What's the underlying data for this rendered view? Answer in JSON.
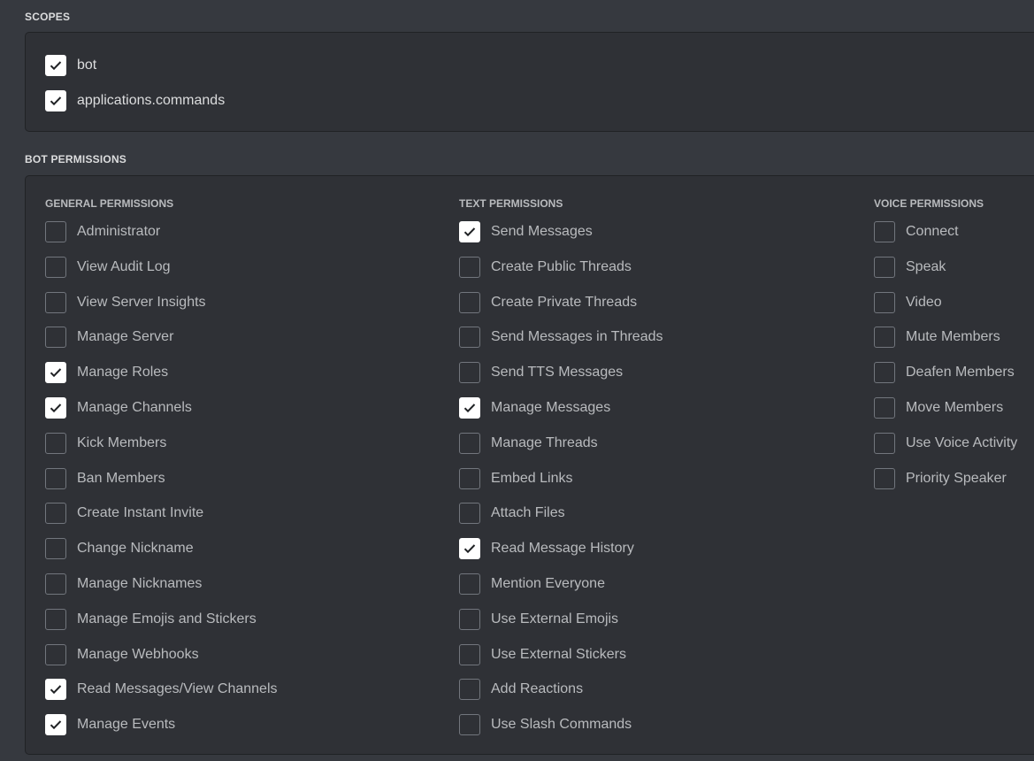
{
  "scopes": {
    "title": "SCOPES",
    "items": [
      {
        "label": "bot",
        "checked": true
      },
      {
        "label": "applications.commands",
        "checked": true
      }
    ]
  },
  "bot_permissions": {
    "title": "BOT PERMISSIONS",
    "columns": [
      {
        "title": "GENERAL PERMISSIONS",
        "items": [
          {
            "label": "Administrator",
            "checked": false
          },
          {
            "label": "View Audit Log",
            "checked": false
          },
          {
            "label": "View Server Insights",
            "checked": false
          },
          {
            "label": "Manage Server",
            "checked": false
          },
          {
            "label": "Manage Roles",
            "checked": true
          },
          {
            "label": "Manage Channels",
            "checked": true
          },
          {
            "label": "Kick Members",
            "checked": false
          },
          {
            "label": "Ban Members",
            "checked": false
          },
          {
            "label": "Create Instant Invite",
            "checked": false
          },
          {
            "label": "Change Nickname",
            "checked": false
          },
          {
            "label": "Manage Nicknames",
            "checked": false
          },
          {
            "label": "Manage Emojis and Stickers",
            "checked": false
          },
          {
            "label": "Manage Webhooks",
            "checked": false
          },
          {
            "label": "Read Messages/View Channels",
            "checked": true
          },
          {
            "label": "Manage Events",
            "checked": true
          }
        ]
      },
      {
        "title": "TEXT PERMISSIONS",
        "items": [
          {
            "label": "Send Messages",
            "checked": true
          },
          {
            "label": "Create Public Threads",
            "checked": false
          },
          {
            "label": "Create Private Threads",
            "checked": false
          },
          {
            "label": "Send Messages in Threads",
            "checked": false
          },
          {
            "label": "Send TTS Messages",
            "checked": false
          },
          {
            "label": "Manage Messages",
            "checked": true
          },
          {
            "label": "Manage Threads",
            "checked": false
          },
          {
            "label": "Embed Links",
            "checked": false
          },
          {
            "label": "Attach Files",
            "checked": false
          },
          {
            "label": "Read Message History",
            "checked": true
          },
          {
            "label": "Mention Everyone",
            "checked": false
          },
          {
            "label": "Use External Emojis",
            "checked": false
          },
          {
            "label": "Use External Stickers",
            "checked": false
          },
          {
            "label": "Add Reactions",
            "checked": false
          },
          {
            "label": "Use Slash Commands",
            "checked": false
          }
        ]
      },
      {
        "title": "VOICE PERMISSIONS",
        "items": [
          {
            "label": "Connect",
            "checked": false
          },
          {
            "label": "Speak",
            "checked": false
          },
          {
            "label": "Video",
            "checked": false
          },
          {
            "label": "Mute Members",
            "checked": false
          },
          {
            "label": "Deafen Members",
            "checked": false
          },
          {
            "label": "Move Members",
            "checked": false
          },
          {
            "label": "Use Voice Activity",
            "checked": false
          },
          {
            "label": "Priority Speaker",
            "checked": false
          }
        ]
      }
    ]
  }
}
